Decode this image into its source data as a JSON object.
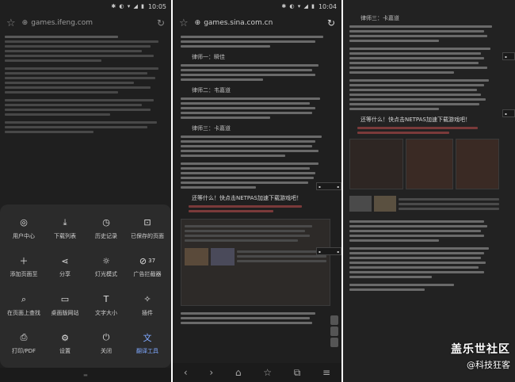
{
  "left_panel": {
    "status_time": "10:05",
    "url": "games.ifeng.com",
    "menu_items": [
      {
        "label": "用户中心",
        "icon": "user-circle-icon"
      },
      {
        "label": "下载列表",
        "icon": "download-icon"
      },
      {
        "label": "历史记录",
        "icon": "clock-icon"
      },
      {
        "label": "已保存的页面",
        "icon": "saved-page-icon"
      },
      {
        "label": "添加页面至",
        "icon": "plus-icon"
      },
      {
        "label": "分享",
        "icon": "share-icon"
      },
      {
        "label": "灯光模式",
        "icon": "sun-icon"
      },
      {
        "label": "广告拦截器",
        "icon": "block-icon",
        "badge": "37"
      },
      {
        "label": "在页面上查找",
        "icon": "find-in-page-icon"
      },
      {
        "label": "桌面版网站",
        "icon": "desktop-icon"
      },
      {
        "label": "文字大小",
        "icon": "text-size-icon"
      },
      {
        "label": "插件",
        "icon": "plugin-icon"
      },
      {
        "label": "打印/PDF",
        "icon": "print-icon"
      },
      {
        "label": "设置",
        "icon": "gear-icon"
      },
      {
        "label": "关闭",
        "icon": "power-icon"
      },
      {
        "label": "翻译工具",
        "icon": "translate-icon",
        "active": true
      }
    ]
  },
  "middle_panel": {
    "status_time": "10:04",
    "url": "games.sina.com.cn",
    "headings": [
      "律师一：瞬佳",
      "律师二：韦嘉道",
      "律师三：卡嘉道"
    ],
    "highlight": "还等什么！快点击NETPAS加速下载游戏吧！"
  },
  "right_panel": {
    "heading": "律师三：卡嘉道",
    "highlight": "还等什么！快点击NETPAS加速下载游戏吧！"
  },
  "watermark": {
    "line1": "盖乐世社区",
    "line2": "@科技狂客"
  },
  "colors": {
    "background": "#1f1f1f",
    "menu_bg": "#2b2b2b",
    "accent": "#7fa8ff"
  }
}
